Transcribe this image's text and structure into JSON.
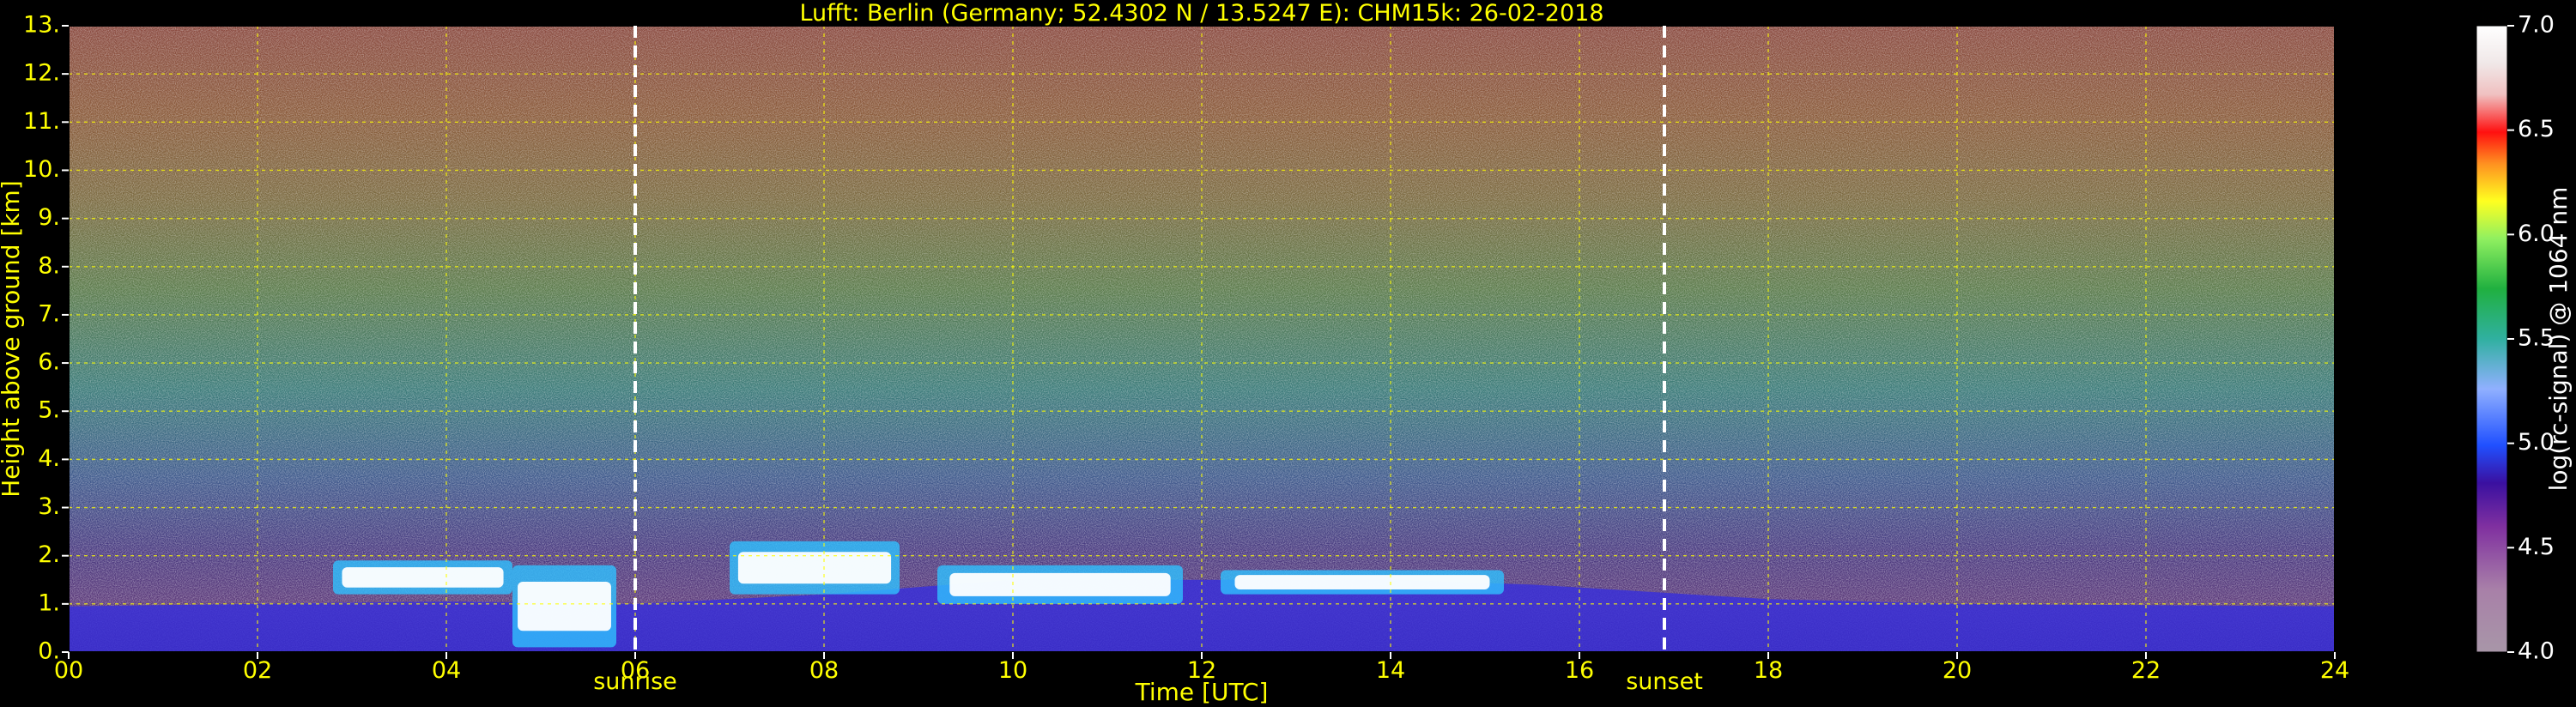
{
  "chart_data": {
    "type": "heatmap",
    "title": "Lufft: Berlin (Germany; 52.4302 N / 13.5247 E):    CHM15k: 26-02-2018",
    "xlabel": "Time [UTC]",
    "ylabel": "Height above ground [km]",
    "xlim": [
      0,
      24
    ],
    "ylim": [
      0,
      13
    ],
    "x_ticks": [
      "00",
      "02",
      "04",
      "06",
      "08",
      "10",
      "12",
      "14",
      "16",
      "18",
      "20",
      "22",
      "24"
    ],
    "y_ticks": [
      "0.",
      "1.",
      "2.",
      "3.",
      "4.",
      "5.",
      "6.",
      "7.",
      "8.",
      "9.",
      "10.",
      "11.",
      "12.",
      "13."
    ],
    "grid": true,
    "annotations": [
      {
        "text": "sunrise",
        "x": 6.0
      },
      {
        "text": "sunset",
        "x": 16.9
      }
    ],
    "colorbar": {
      "label": "log(rc-signal) @ 1064 nm",
      "range": [
        4.0,
        7.0
      ],
      "ticks": [
        "4.0",
        "4.5",
        "5.0",
        "5.5",
        "6.0",
        "6.5",
        "7.0"
      ]
    },
    "boundary_layer": [
      {
        "t": 0.0,
        "h": 0.95
      },
      {
        "t": 2.0,
        "h": 1.0
      },
      {
        "t": 4.0,
        "h": 1.05
      },
      {
        "t": 6.0,
        "h": 1.0
      },
      {
        "t": 8.0,
        "h": 1.2
      },
      {
        "t": 10.0,
        "h": 1.5
      },
      {
        "t": 12.0,
        "h": 1.5
      },
      {
        "t": 14.0,
        "h": 1.5
      },
      {
        "t": 15.5,
        "h": 1.4
      },
      {
        "t": 18.0,
        "h": 1.1
      },
      {
        "t": 20.0,
        "h": 1.0
      },
      {
        "t": 24.0,
        "h": 0.95
      }
    ],
    "cloud_layers": [
      {
        "t_start": 2.8,
        "t_end": 4.7,
        "h_base": 1.2,
        "h_top": 1.9
      },
      {
        "t_start": 4.7,
        "t_end": 5.8,
        "h_base": 0.1,
        "h_top": 1.8
      },
      {
        "t_start": 7.0,
        "t_end": 8.8,
        "h_base": 1.2,
        "h_top": 2.3
      },
      {
        "t_start": 9.2,
        "t_end": 11.8,
        "h_base": 1.0,
        "h_top": 1.8
      },
      {
        "t_start": 12.2,
        "t_end": 15.2,
        "h_base": 1.2,
        "h_top": 1.7
      }
    ]
  }
}
